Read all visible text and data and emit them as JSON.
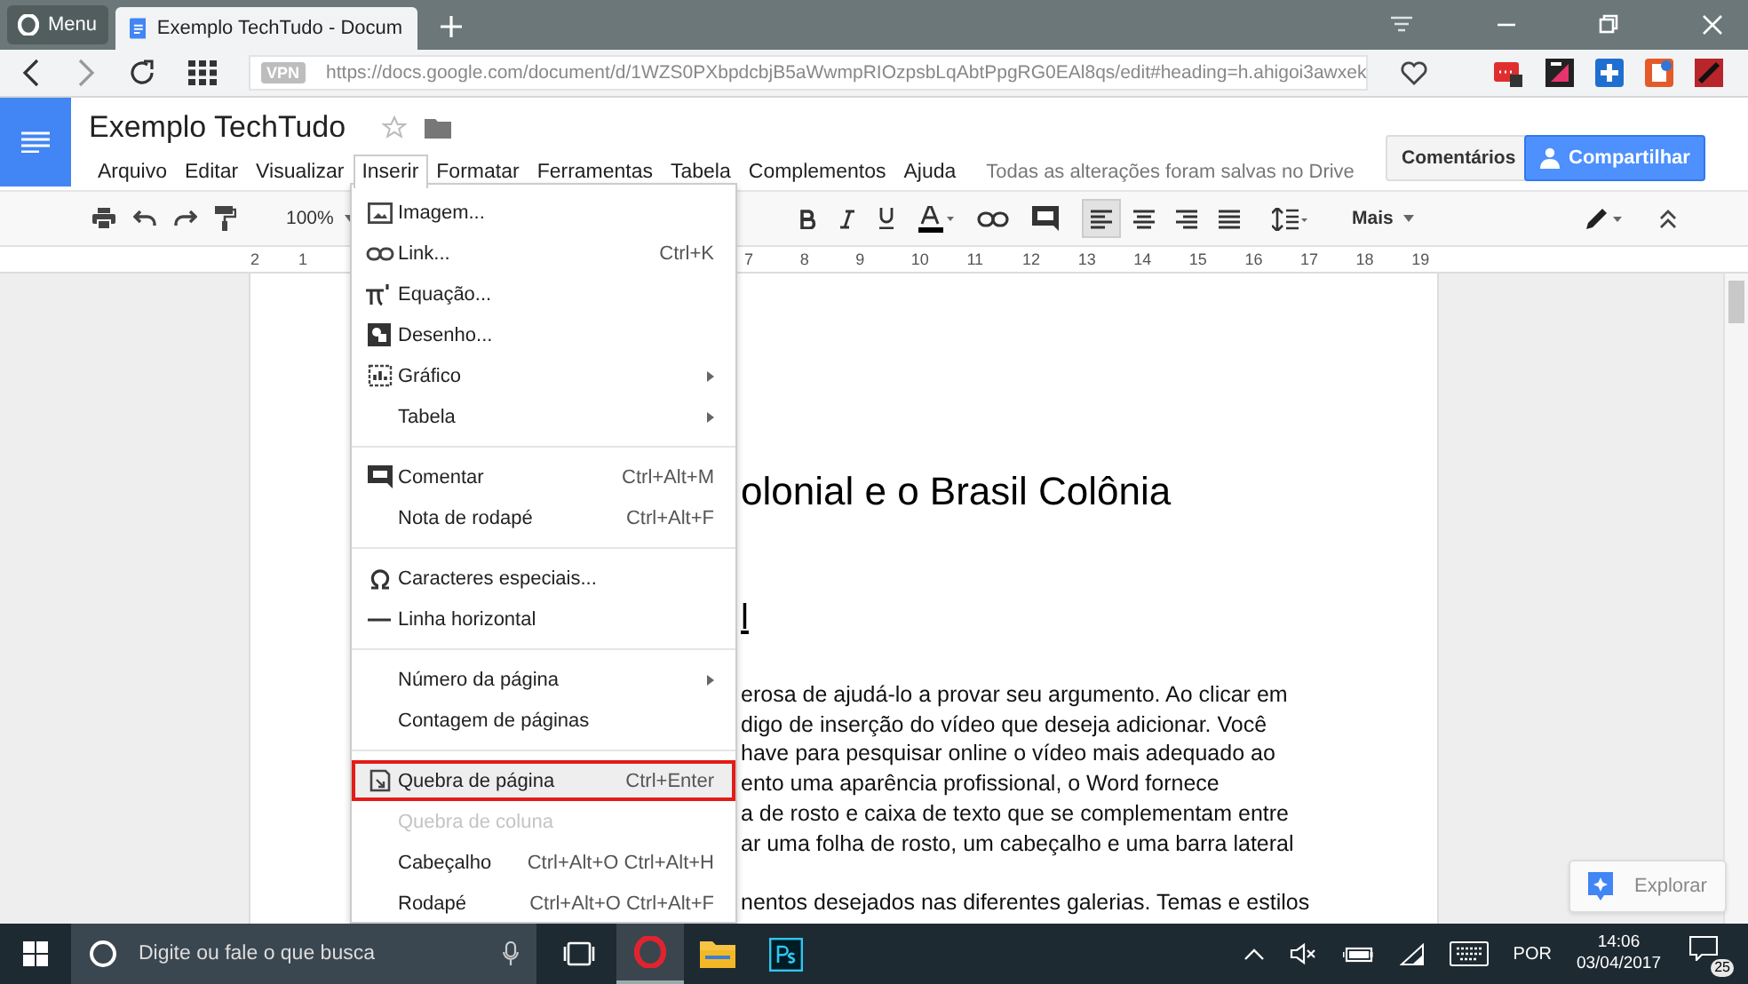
{
  "browser": {
    "menu_label": "Menu",
    "tabs": [
      {
        "title": "Exemplo TechTudo - Docum",
        "selected": true
      }
    ],
    "vpn_label": "VPN",
    "url": "https://docs.google.com/document/d/1WZS0PXbpdcbjB5aWwmpRIOzpsbLqAbtPpgRG0EAl8qs/edit#heading=h.ahigoi3awxek"
  },
  "docs": {
    "title": "Exemplo TechTudo",
    "menus": [
      {
        "label": "Arquivo",
        "selected": false
      },
      {
        "label": "Editar",
        "selected": false
      },
      {
        "label": "Visualizar",
        "selected": false
      },
      {
        "label": "Inserir",
        "selected": true
      },
      {
        "label": "Formatar",
        "selected": false
      },
      {
        "label": "Ferramentas",
        "selected": false
      },
      {
        "label": "Tabela",
        "selected": false
      },
      {
        "label": "Complementos",
        "selected": false
      },
      {
        "label": "Ajuda",
        "selected": false
      }
    ],
    "save_status": "Todas as alterações foram salvas no Drive",
    "comments_button": "Comentários",
    "share_button": "Compartilhar"
  },
  "toolbar": {
    "zoom": "100%",
    "more": "Mais",
    "alignments": [
      {
        "kind": "left",
        "selected": true
      },
      {
        "kind": "center",
        "selected": false
      },
      {
        "kind": "right",
        "selected": false
      },
      {
        "kind": "justify",
        "selected": false
      }
    ]
  },
  "ruler": {
    "left_numbers": [
      "2",
      "1"
    ],
    "right_numbers": [
      "7",
      "8",
      "9",
      "10",
      "11",
      "12",
      "13",
      "14",
      "15",
      "16",
      "17",
      "18",
      "19"
    ]
  },
  "insert_menu": [
    {
      "kind": "image",
      "label": "Imagem..."
    },
    {
      "kind": "link",
      "label": "Link...",
      "shortcut": "Ctrl+K"
    },
    {
      "kind": "equation",
      "label": "Equação..."
    },
    {
      "kind": "drawing",
      "label": "Desenho..."
    },
    {
      "kind": "chart",
      "label": "Gráfico",
      "submenu": true
    },
    {
      "kind": "plain",
      "label": "Tabela",
      "submenu": true
    },
    {
      "kind": "separator"
    },
    {
      "kind": "comment",
      "label": "Comentar",
      "shortcut": "Ctrl+Alt+M"
    },
    {
      "kind": "plain",
      "label": "Nota de rodapé",
      "shortcut": "Ctrl+Alt+F"
    },
    {
      "kind": "separator"
    },
    {
      "kind": "special",
      "label": "Caracteres especiais..."
    },
    {
      "kind": "line",
      "label": "Linha horizontal"
    },
    {
      "kind": "separator"
    },
    {
      "kind": "plain",
      "label": "Número da página",
      "submenu": true
    },
    {
      "kind": "plain",
      "label": "Contagem de páginas"
    },
    {
      "kind": "separator"
    },
    {
      "kind": "pagebreak",
      "label": "Quebra de página",
      "shortcut": "Ctrl+Enter",
      "selected": true
    },
    {
      "kind": "plain",
      "label": "Quebra de coluna",
      "disabled": true
    },
    {
      "kind": "plain",
      "label": "Cabeçalho",
      "shortcut": "Ctrl+Alt+O Ctrl+Alt+H"
    },
    {
      "kind": "plain",
      "label": "Rodapé",
      "shortcut": "Ctrl+Alt+O Ctrl+Alt+F"
    }
  ],
  "document": {
    "heading": "olonial e o Brasil Colônia",
    "subheading": "l",
    "paragraphs": [
      [
        "erosa de ajudá-lo a provar seu argumento. Ao clicar em",
        "digo de inserção do vídeo que deseja adicionar. Você",
        "have para pesquisar online o vídeo mais adequado ao",
        "ento uma aparência profissional, o Word fornece",
        "a de rosto e caixa de texto que se complementam entre",
        "ar uma folha de rosto, um cabeçalho e uma barra lateral"
      ],
      [
        "nentos desejados nas diferentes galerias. Temas e estilos"
      ]
    ]
  },
  "explore_button": "Explorar",
  "taskbar": {
    "search_placeholder": "Digite ou fale o que busca",
    "apps": [
      {
        "kind": "browser",
        "selected": true
      },
      {
        "kind": "folder",
        "selected": false
      },
      {
        "kind": "photoshop",
        "selected": false
      }
    ],
    "language": "POR",
    "time": "14:06",
    "date": "03/04/2017",
    "notifications": "25"
  }
}
